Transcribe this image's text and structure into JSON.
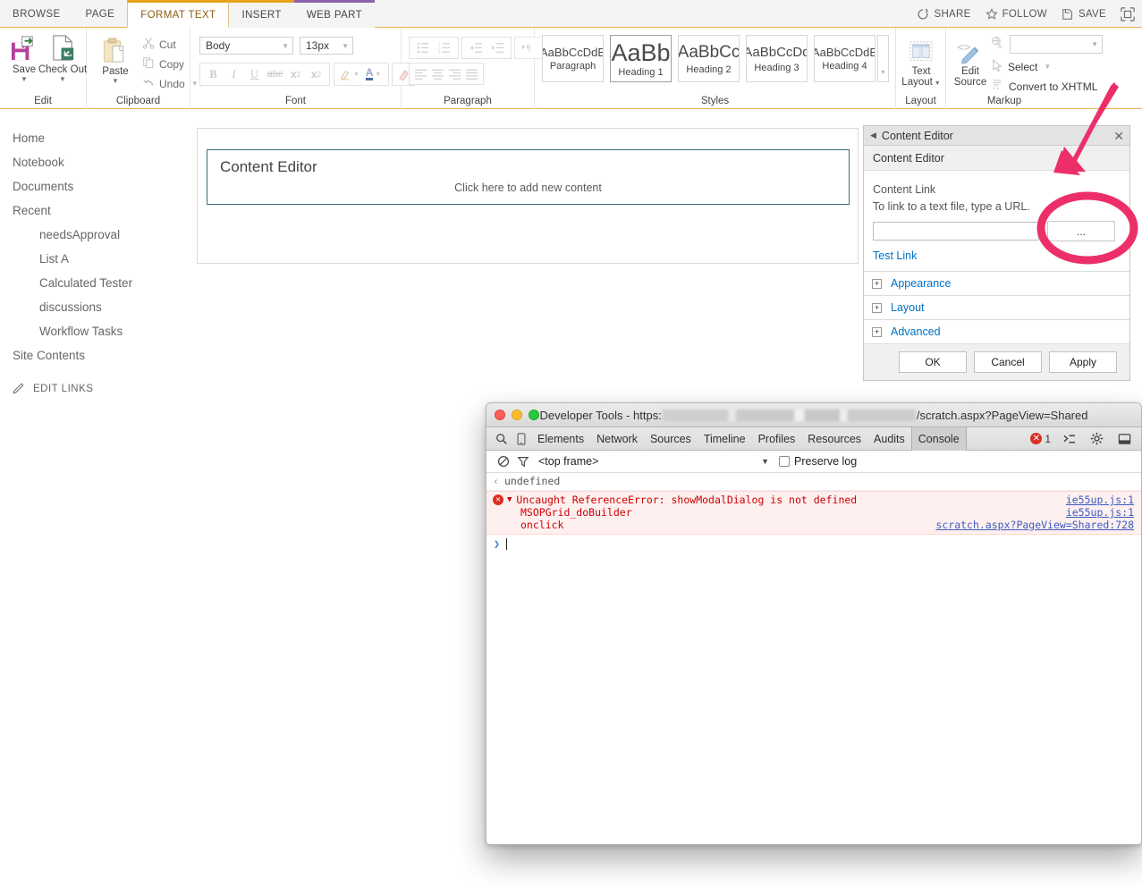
{
  "ribbon": {
    "tabs": [
      {
        "label": "BROWSE",
        "state": "plain"
      },
      {
        "label": "PAGE",
        "state": "plain"
      },
      {
        "label": "FORMAT TEXT",
        "state": "active"
      },
      {
        "label": "INSERT",
        "state": "accent-orange"
      },
      {
        "label": "WEB PART",
        "state": "accent-purple"
      }
    ],
    "suite": [
      {
        "label": "SHARE",
        "icon": "share-icon"
      },
      {
        "label": "FOLLOW",
        "icon": "star-icon"
      },
      {
        "label": "SAVE",
        "icon": "save-icon"
      }
    ],
    "focus_icon": "focus-on-content-icon",
    "groups": {
      "edit": {
        "label": "Edit",
        "save": "Save",
        "checkout": "Check Out"
      },
      "clipboard": {
        "label": "Clipboard",
        "paste": "Paste",
        "cut": "Cut",
        "copy": "Copy",
        "undo": "Undo"
      },
      "font": {
        "label": "Font",
        "family_value": "Body",
        "size_value": "13px",
        "bold": "B",
        "italic": "I",
        "underline": "U",
        "strike": "abc",
        "subscript": "x",
        "superscript": "x",
        "highlight": "highlight-color-icon",
        "fontcolor": "A",
        "clear": "clear-format-icon"
      },
      "paragraph": {
        "label": "Paragraph"
      },
      "styles": {
        "label": "Styles",
        "items": [
          {
            "sample": "AaBbCcDdE",
            "name": "Paragraph",
            "size": 13
          },
          {
            "sample": "AaBb",
            "name": "Heading 1",
            "size": 27
          },
          {
            "sample": "AaBbCc",
            "name": "Heading 2",
            "size": 19
          },
          {
            "sample": "AaBbCcDd",
            "name": "Heading 3",
            "size": 15
          },
          {
            "sample": "AaBbCcDdE",
            "name": "Heading 4",
            "size": 13
          }
        ]
      },
      "layout": {
        "label": "Layout",
        "text_layout_line1": "Text",
        "text_layout_line2": "Layout"
      },
      "markup": {
        "label": "Markup",
        "edit_source_line1": "Edit",
        "edit_source_line2": "Source",
        "language_value": "",
        "select": "Select",
        "convert": "Convert to XHTML"
      }
    }
  },
  "leftnav": {
    "items": [
      {
        "label": "Home",
        "sub": false
      },
      {
        "label": "Notebook",
        "sub": false
      },
      {
        "label": "Documents",
        "sub": false
      },
      {
        "label": "Recent",
        "sub": false
      },
      {
        "label": "needsApproval",
        "sub": true
      },
      {
        "label": "List A",
        "sub": true
      },
      {
        "label": "Calculated Tester",
        "sub": true
      },
      {
        "label": "discussions",
        "sub": true
      },
      {
        "label": "Workflow Tasks",
        "sub": true
      },
      {
        "label": "Site Contents",
        "sub": false
      }
    ],
    "edit_links": "EDIT LINKS"
  },
  "main": {
    "webpart_title": "Content Editor",
    "placeholder": "Click here to add new content"
  },
  "toolpane": {
    "titlebar": "Content Editor",
    "back_icon": "chevron-left-icon",
    "close_icon": "close-icon",
    "subheader": "Content Editor",
    "content_link_label": "Content Link",
    "content_link_hint": "To link to a text file, type a URL.",
    "url_value": "",
    "browse_button": "...",
    "test_link": "Test Link",
    "sections": [
      {
        "label": "Appearance",
        "expander": "+"
      },
      {
        "label": "Layout",
        "expander": "+"
      },
      {
        "label": "Advanced",
        "expander": "+"
      }
    ],
    "buttons": {
      "ok": "OK",
      "cancel": "Cancel",
      "apply": "Apply"
    }
  },
  "annotation": {
    "color": "#ec2f69",
    "shapes": "arrow-and-ellipse-highlight"
  },
  "devtools": {
    "title_prefix": "Developer Tools - https:",
    "title_suffix": "/scratch.aspx?PageView=Shared",
    "panels": [
      "Elements",
      "Network",
      "Sources",
      "Timeline",
      "Profiles",
      "Resources",
      "Audits",
      "Console"
    ],
    "selected_panel": "Console",
    "error_count": "1",
    "toolbar_icons": [
      "search-icon",
      "device-toolbar-icon",
      "console-drawer-icon",
      "settings-gear-icon",
      "dock-side-icon"
    ],
    "filterbar": {
      "clear_icon": "clear-console-icon",
      "filter_icon": "filter-icon",
      "frame": "<top frame>",
      "preserve_log": "Preserve log",
      "preserve_checked": false
    },
    "console": {
      "result": "undefined",
      "error": {
        "message": "Uncaught ReferenceError: showModalDialog is not defined",
        "source": "ie55up.js:1",
        "stack": [
          {
            "fn": "MSOPGrid_doBuilder",
            "source": "ie55up.js:1"
          },
          {
            "fn": "onclick",
            "source": "scratch.aspx?PageView=Shared:728"
          }
        ]
      }
    }
  }
}
